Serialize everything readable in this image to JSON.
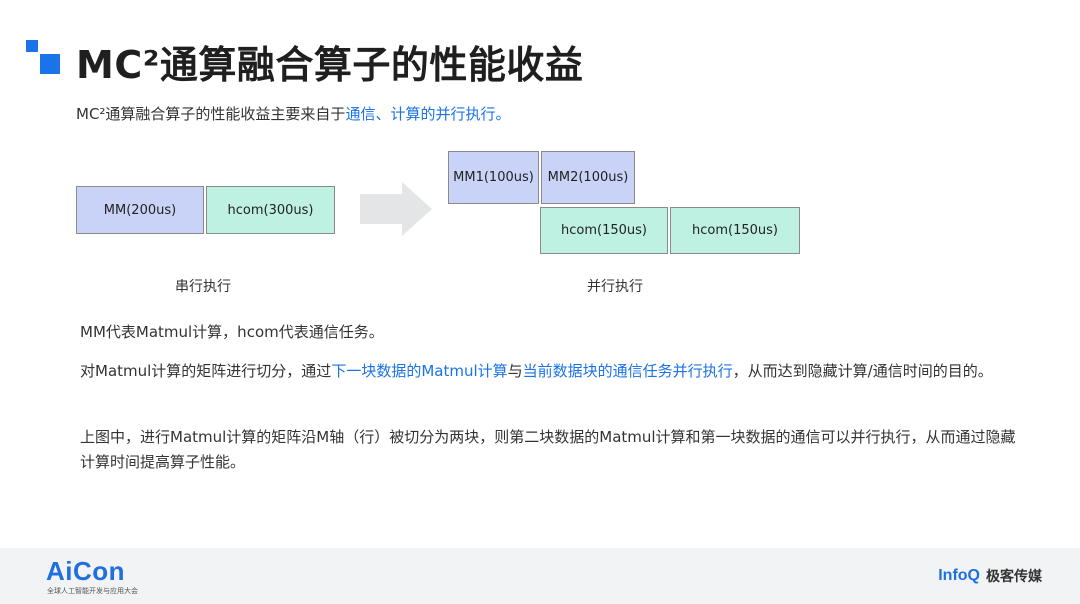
{
  "header": {
    "title": "MC²通算融合算子的性能收益"
  },
  "intro": {
    "text_prefix": "MC²通算融合算子的性能收益主要来自于",
    "text_highlight": "通信、计算的并行执行。"
  },
  "diagram": {
    "serial": {
      "boxes": [
        "MM(200us)",
        "hcom(300us)"
      ],
      "caption": "串行执行"
    },
    "parallel": {
      "mm_boxes": [
        "MM1(100us)",
        "MM2(100us)"
      ],
      "hcom_boxes": [
        "hcom(150us)",
        "hcom(150us)"
      ],
      "caption": "并行执行"
    },
    "colors": {
      "mm": "#c9d3f7",
      "hcom": "#bff1e3",
      "arrow": "#e4e5e7"
    }
  },
  "notes": {
    "legend": "MM代表Matmul计算，hcom代表通信任务。",
    "para1_a": "对Matmul计算的矩阵进行切分，通过",
    "para1_b": "下一块数据的Matmul计算",
    "para1_c": "与",
    "para1_d": "当前数据块的通信任务并行执行",
    "para1_e": "，从而达到隐藏计算/通信时间的目的。",
    "para2": "上图中，进行Matmul计算的矩阵沿M轴（行）被切分为两块，则第二块数据的Matmul计算和第一块数据的通信可以并行执行，从而通过隐藏计算时间提高算子性能。"
  },
  "footer": {
    "aicon_logo": "AiCon",
    "aicon_sub": "全球人工智能开发与应用大会",
    "infoq_logo": "InfoQ",
    "infoq_cn": "极客传媒"
  },
  "accent_color": "#1a73e8"
}
